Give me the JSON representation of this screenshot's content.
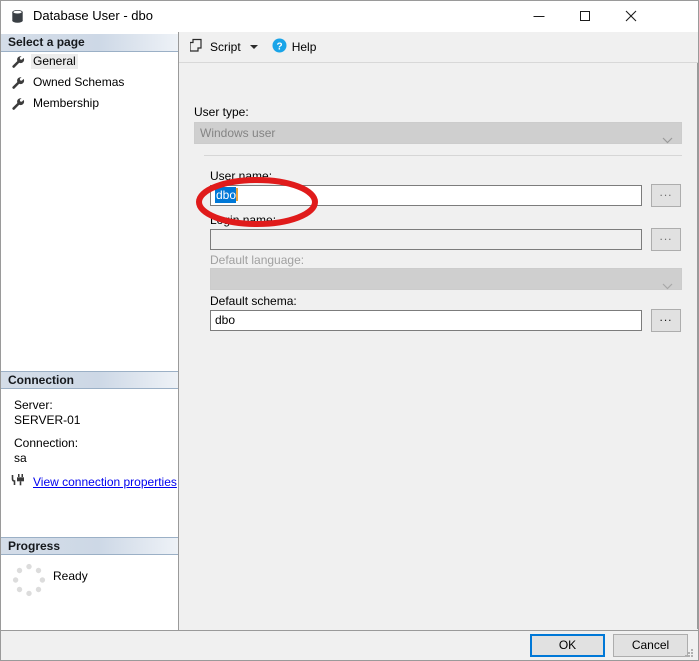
{
  "window": {
    "title": "Database User - dbo",
    "icon": "database-icon",
    "controls": {
      "minimize": "minimize-icon",
      "maximize": "maximize-icon",
      "close": "close-icon"
    }
  },
  "sidebar": {
    "select_a_page_header": "Select a page",
    "pages": [
      {
        "label": "General",
        "icon": "wrench-icon",
        "selected": true
      },
      {
        "label": "Owned Schemas",
        "icon": "wrench-icon",
        "selected": false
      },
      {
        "label": "Membership",
        "icon": "wrench-icon",
        "selected": false
      }
    ],
    "connection": {
      "header": "Connection",
      "server_label": "Server:",
      "server_value": "SERVER-01",
      "connection_label": "Connection:",
      "connection_value": "sa",
      "link_text": "View connection properties",
      "link_icon": "plug-icon",
      "link_color": "#0000ee"
    },
    "progress": {
      "header": "Progress",
      "status": "Ready",
      "spinner_icon": "spinner-icon"
    }
  },
  "toolbar": {
    "script_label": "Script",
    "script_icon": "script-icon",
    "script_dropdown_icon": "chevron-down-icon",
    "help_label": "Help",
    "help_icon": "help-circle-icon"
  },
  "form": {
    "user_type": {
      "label": "User type:",
      "value": "Windows user",
      "disabled": true
    },
    "user_name": {
      "label": "User name:",
      "value": "dbo",
      "selected_text": "dbo",
      "browse_label": "...",
      "browse_disabled": true
    },
    "login_name": {
      "label": "Login name:",
      "value": "",
      "browse_label": "...",
      "browse_disabled": true
    },
    "default_language": {
      "label": "Default language:",
      "value": "",
      "disabled": true
    },
    "default_schema": {
      "label": "Default schema:",
      "value": "dbo",
      "browse_label": "...",
      "browse_disabled": false
    }
  },
  "footer": {
    "ok_label": "OK",
    "cancel_label": "Cancel"
  },
  "annotation": {
    "shape": "ellipse",
    "color": "#e01b1b",
    "targets": "login-name-field"
  }
}
